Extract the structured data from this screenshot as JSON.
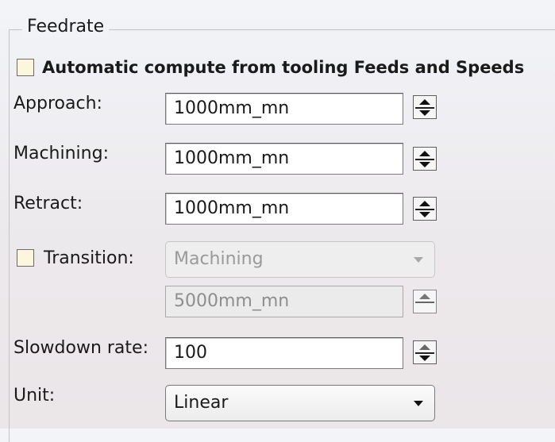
{
  "group": {
    "title": "Feedrate"
  },
  "auto_compute": {
    "label": "Automatic compute from tooling Feeds and Speeds",
    "checked": false
  },
  "approach": {
    "label": "Approach:",
    "value": "1000mm_mn"
  },
  "machining": {
    "label": "Machining:",
    "value": "1000mm_mn"
  },
  "retract": {
    "label": "Retract:",
    "value": "1000mm_mn"
  },
  "transition": {
    "label": "Transition:",
    "checked": false,
    "mode": "Machining",
    "value": "5000mm_mn"
  },
  "slowdown": {
    "label": "Slowdown rate:",
    "value": "100"
  },
  "unit": {
    "label": "Unit:",
    "value": "Linear"
  },
  "colors": {
    "checkbox_fill": "#fcf7dc",
    "background": "#efeeef"
  }
}
